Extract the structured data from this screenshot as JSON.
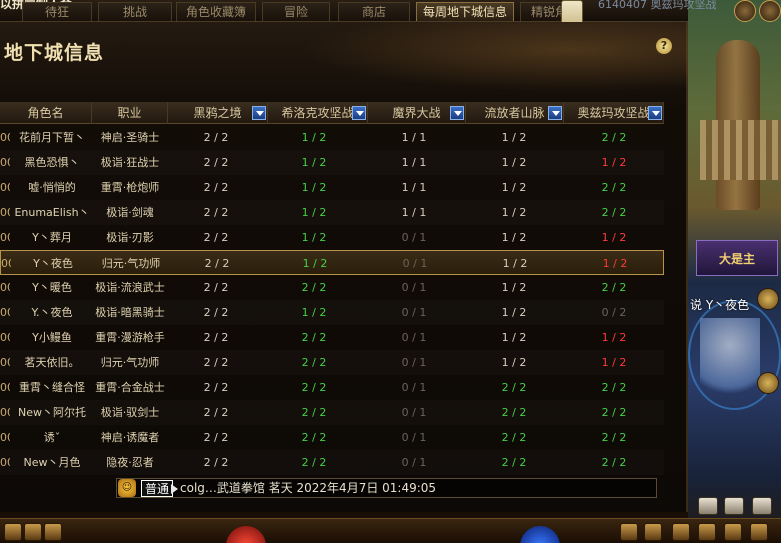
{
  "top": {
    "title": "以拼冒制人会",
    "tabs": [
      "待狂",
      "挑战",
      "角色收藏簿",
      "冒险",
      "商店",
      "每周地下城信息",
      "精锐角"
    ],
    "active_tab": 5,
    "right_info": "6140407 奥兹玛攻坚战"
  },
  "panel": {
    "title": "地下城信息",
    "help": "?"
  },
  "columns": {
    "name": "角色名",
    "job": "职业",
    "dungeons": [
      "黑鸦之境",
      "希洛克攻坚战",
      "魔界大战",
      "流放者山脉",
      "奥兹玛攻坚战"
    ]
  },
  "rows": [
    {
      "prefix": "00",
      "name": "花前月下暂丶",
      "job": "神启·圣骑士",
      "vals": [
        "2 / 2",
        "1 / 2",
        "1 / 1",
        "1 / 2",
        "2 / 2"
      ],
      "colors": [
        "white",
        "green",
        "white",
        "white",
        "green"
      ]
    },
    {
      "prefix": "00",
      "name": "黑色恐惧丶",
      "job": "极诣·狂战士",
      "vals": [
        "2 / 2",
        "1 / 2",
        "1 / 1",
        "1 / 2",
        "1 / 2"
      ],
      "colors": [
        "white",
        "green",
        "white",
        "white",
        "red"
      ]
    },
    {
      "prefix": "00",
      "name": "嘘·悄悄的",
      "job": "重霄·枪炮师",
      "vals": [
        "2 / 2",
        "1 / 2",
        "1 / 1",
        "1 / 2",
        "2 / 2"
      ],
      "colors": [
        "white",
        "green",
        "white",
        "white",
        "green"
      ]
    },
    {
      "prefix": "00",
      "name": "EnumaElish丶",
      "job": "极诣·剑魂",
      "vals": [
        "2 / 2",
        "1 / 2",
        "1 / 1",
        "1 / 2",
        "2 / 2"
      ],
      "colors": [
        "white",
        "green",
        "white",
        "white",
        "green"
      ]
    },
    {
      "prefix": "00",
      "name": "Y丶葬月",
      "job": "极诣·刃影",
      "vals": [
        "2 / 2",
        "1 / 2",
        "0 / 1",
        "1 / 2",
        "1 / 2"
      ],
      "colors": [
        "white",
        "green",
        "gray",
        "white",
        "red"
      ]
    },
    {
      "prefix": "00",
      "name": "Y丶夜色",
      "job": "归元·气功师",
      "vals": [
        "2 / 2",
        "1 / 2",
        "0 / 1",
        "1 / 2",
        "1 / 2"
      ],
      "colors": [
        "white",
        "green",
        "gray",
        "white",
        "red"
      ]
    },
    {
      "prefix": "00",
      "name": "Y丶暖色",
      "job": "极诣·流浪武士",
      "vals": [
        "2 / 2",
        "2 / 2",
        "0 / 1",
        "1 / 2",
        "2 / 2"
      ],
      "colors": [
        "white",
        "green",
        "gray",
        "white",
        "green"
      ]
    },
    {
      "prefix": "00",
      "name": "Y.丶夜色",
      "job": "极诣·暗黑骑士",
      "vals": [
        "2 / 2",
        "1 / 2",
        "0 / 1",
        "1 / 2",
        "0 / 2"
      ],
      "colors": [
        "white",
        "green",
        "gray",
        "white",
        "gray"
      ]
    },
    {
      "prefix": "00",
      "name": "Y小鳗鱼",
      "job": "重霄·漫游枪手",
      "vals": [
        "2 / 2",
        "2 / 2",
        "0 / 1",
        "1 / 2",
        "1 / 2"
      ],
      "colors": [
        "white",
        "green",
        "gray",
        "white",
        "red"
      ]
    },
    {
      "prefix": "00",
      "name": "茗天依旧。",
      "job": "归元·气功师",
      "vals": [
        "2 / 2",
        "2 / 2",
        "0 / 1",
        "1 / 2",
        "1 / 2"
      ],
      "colors": [
        "white",
        "green",
        "gray",
        "white",
        "red"
      ]
    },
    {
      "prefix": "00",
      "name": "重霄丶缝合怪",
      "job": "重霄·合金战士",
      "vals": [
        "2 / 2",
        "2 / 2",
        "0 / 1",
        "2 / 2",
        "2 / 2"
      ],
      "colors": [
        "white",
        "green",
        "gray",
        "green",
        "green"
      ]
    },
    {
      "prefix": "00",
      "name": "New丶阿尔托",
      "job": "极诣·驭剑士",
      "vals": [
        "2 / 2",
        "2 / 2",
        "0 / 1",
        "2 / 2",
        "2 / 2"
      ],
      "colors": [
        "white",
        "green",
        "gray",
        "green",
        "green"
      ]
    },
    {
      "prefix": "00",
      "name": "诱ˇ",
      "job": "神启·诱魔者",
      "vals": [
        "2 / 2",
        "2 / 2",
        "0 / 1",
        "2 / 2",
        "2 / 2"
      ],
      "colors": [
        "white",
        "green",
        "gray",
        "green",
        "green"
      ]
    },
    {
      "prefix": "00",
      "name": "New丶月色",
      "job": "隐夜·忍者",
      "vals": [
        "2 / 2",
        "2 / 2",
        "0 / 1",
        "2 / 2",
        "2 / 2"
      ],
      "colors": [
        "white",
        "green",
        "gray",
        "green",
        "green"
      ]
    }
  ],
  "selected_row": 5,
  "chat": {
    "face": "☺",
    "channel": "普通",
    "text": "colg…武道拳馆 茗天 2022年4月7日 01:49:05"
  },
  "side": {
    "mascot_banner": "大是主",
    "caption": "说 Y丶夜色"
  }
}
